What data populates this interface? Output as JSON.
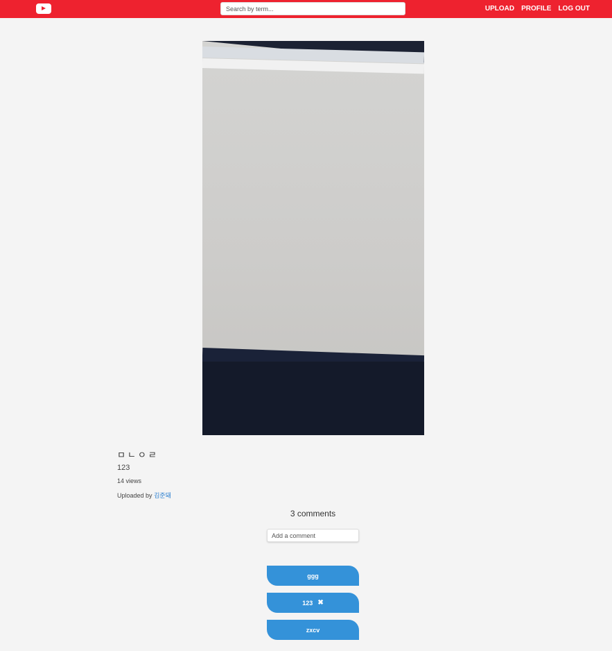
{
  "header": {
    "logo_icon": "youtube-play-icon",
    "brand_color": "#ee222f",
    "search": {
      "placeholder": "Search by term...",
      "value": ""
    },
    "nav": [
      {
        "label": "UPLOAD"
      },
      {
        "label": "PROFILE"
      },
      {
        "label": "LOG OUT"
      }
    ]
  },
  "video": {
    "title": "ㅁㄴㅇㄹ",
    "description": "123",
    "views": "14 views",
    "uploaded_by_label": "Uploaded by",
    "uploader": "김준돼"
  },
  "comments": {
    "count_text": "3 comments",
    "input_placeholder": "Add a comment",
    "accent_color": "#3492d9",
    "items": [
      {
        "text": "ggg",
        "deletable": false
      },
      {
        "text": "123",
        "deletable": true,
        "delete_icon": "✖"
      },
      {
        "text": "zxcv",
        "deletable": false
      }
    ]
  }
}
